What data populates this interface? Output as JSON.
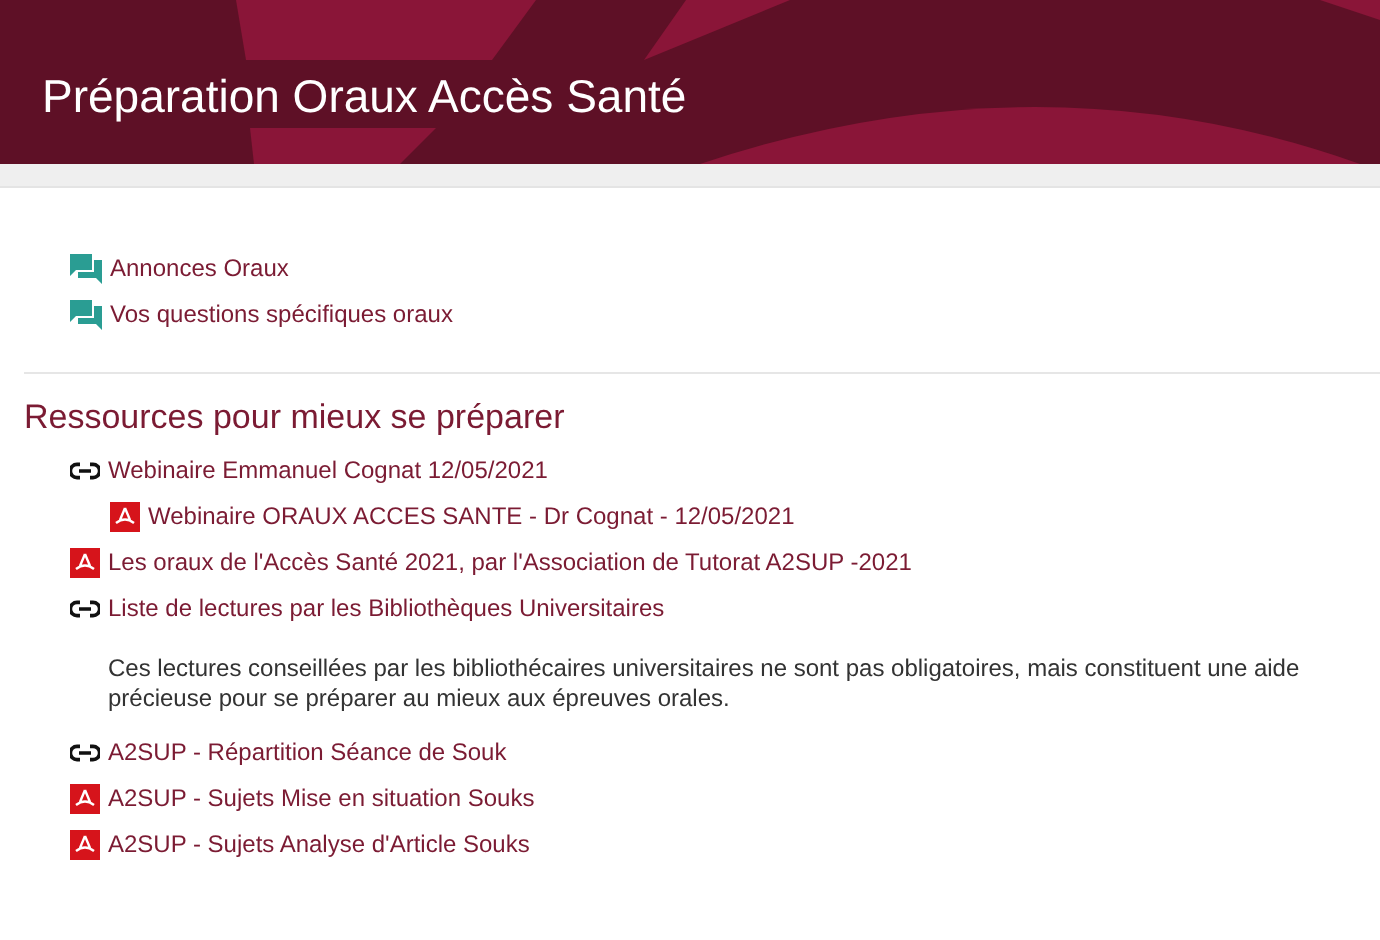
{
  "header": {
    "title": "Préparation Oraux Accès Santé"
  },
  "forums": [
    {
      "label": "Annonces Oraux"
    },
    {
      "label": "Vos questions spécifiques oraux"
    }
  ],
  "section": {
    "title": "Ressources pour mieux se préparer",
    "items": [
      {
        "kind": "link",
        "label": "Webinaire Emmanuel Cognat 12/05/2021",
        "children": [
          {
            "kind": "pdf",
            "label": "Webinaire ORAUX ACCES SANTE - Dr Cognat - 12/05/2021"
          }
        ]
      },
      {
        "kind": "pdf",
        "label": "Les oraux de l'Accès Santé 2021, par l'Association de Tutorat A2SUP -2021"
      },
      {
        "kind": "link",
        "label": "Liste de lectures par les Bibliothèques Universitaires",
        "description": "Ces lectures conseillées par les bibliothécaires universitaires ne sont pas obligatoires, mais constituent une aide précieuse pour se préparer au mieux aux épreuves orales."
      },
      {
        "kind": "link",
        "label": "A2SUP - Répartition Séance de Souk"
      },
      {
        "kind": "pdf",
        "label": "A2SUP - Sujets Mise en situation Souks"
      },
      {
        "kind": "pdf",
        "label": "A2SUP - Sujets Analyse d'Article Souks"
      }
    ]
  }
}
